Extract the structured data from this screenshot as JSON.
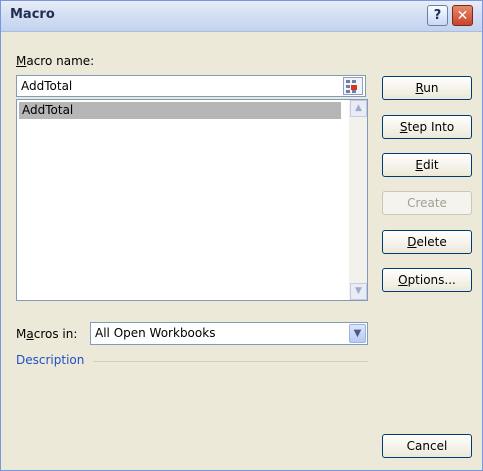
{
  "window": {
    "title": "Macro",
    "help_glyph": "?",
    "close_glyph": "✕"
  },
  "macro_name": {
    "label_prefix": "",
    "label_mnemonic": "M",
    "label_rest": "acro name:",
    "value": "AddTotal"
  },
  "macro_list": {
    "items": [
      "AddTotal"
    ],
    "selected": "AddTotal"
  },
  "buttons": {
    "run": {
      "pre": "",
      "m": "R",
      "post": "un"
    },
    "step_into": {
      "pre": "",
      "m": "S",
      "post": "tep Into"
    },
    "edit": {
      "pre": "",
      "m": "E",
      "post": "dit"
    },
    "create": {
      "label": "Create"
    },
    "delete": {
      "pre": "",
      "m": "D",
      "post": "elete"
    },
    "options": {
      "pre": "",
      "m": "O",
      "post": "ptions..."
    },
    "cancel": {
      "label": "Cancel"
    }
  },
  "macros_in": {
    "label_pre": "M",
    "label_m": "a",
    "label_post": "cros in:",
    "value": "All Open Workbooks"
  },
  "description": {
    "label": "Description"
  },
  "icons": {
    "scroll_up": "▲",
    "scroll_down": "▼",
    "combo_arrow": "▼"
  }
}
